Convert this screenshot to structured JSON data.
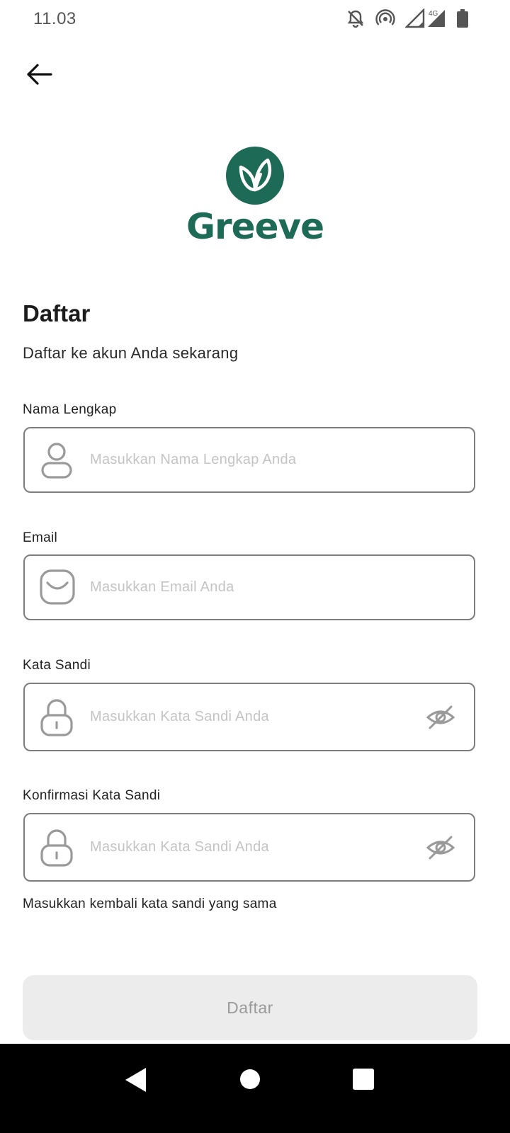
{
  "status_bar": {
    "time": "11.03",
    "icons": [
      "notifications-off-icon",
      "hotspot-icon",
      "signal-icon",
      "signal-4g-icon",
      "battery-icon"
    ],
    "network_label": "4G"
  },
  "header": {
    "back_icon": "arrow-left-icon"
  },
  "logo": {
    "text": "Greeve",
    "color": "#1d6a57"
  },
  "form": {
    "title": "Daftar",
    "subtitle": "Daftar ke akun Anda sekarang",
    "fields": {
      "full_name": {
        "label": "Nama Lengkap",
        "placeholder": "Masukkan Nama Lengkap Anda",
        "value": "",
        "icon": "person-icon"
      },
      "email": {
        "label": "Email",
        "placeholder": "Masukkan Email Anda",
        "value": "",
        "icon": "mail-icon"
      },
      "password": {
        "label": "Kata Sandi",
        "placeholder": "Masukkan Kata Sandi Anda",
        "value": "",
        "icon": "lock-icon",
        "toggle_icon": "eye-off-icon"
      },
      "confirm_password": {
        "label": "Konfirmasi Kata Sandi",
        "placeholder": "Masukkan Kata Sandi Anda",
        "value": "",
        "icon": "lock-icon",
        "toggle_icon": "eye-off-icon"
      }
    },
    "helper": "Masukkan kembali kata sandi yang sama",
    "submit_label": "Daftar"
  },
  "nav_bar": {
    "icons": [
      "back-triangle-icon",
      "home-circle-icon",
      "recents-square-icon"
    ]
  }
}
